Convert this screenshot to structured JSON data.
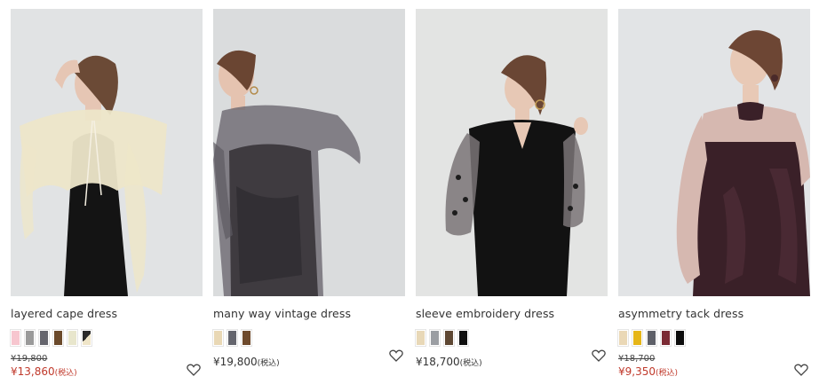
{
  "products": [
    {
      "name": "layered cape dress",
      "swatches": [
        "#f7c6cf",
        "#9a9a9a",
        "#66666e",
        "#6b4a2b",
        "#e8e6cc",
        "split"
      ],
      "old_price": "¥19,800",
      "price": "¥13,860",
      "tax": "(税込)",
      "sale": true,
      "photo": {
        "bg": "#e1e3e4",
        "dress": "#141414",
        "accent": "#ede6c9"
      }
    },
    {
      "name": "many way vintage dress",
      "swatches": [
        "#e9d8b5",
        "#65666e",
        "#6e4a2c"
      ],
      "old_price": "",
      "price": "¥19,800",
      "tax": "(税込)",
      "sale": false,
      "photo": {
        "bg": "#dadcdd",
        "dress": "#3f3b40",
        "accent": "#6b6870"
      }
    },
    {
      "name": "sleeve embroidery dress",
      "swatches": [
        "#e8d8b7",
        "#9b9ea3",
        "#5e4733",
        "#0f0f0f"
      ],
      "old_price": "",
      "price": "¥18,700",
      "tax": "(税込)",
      "sale": false,
      "photo": {
        "bg": "#e3e4e3",
        "dress": "#121212",
        "accent": "#7a7477"
      }
    },
    {
      "name": "asymmetry tack dress",
      "swatches": [
        "#ead8b6",
        "#e6b618",
        "#5e6068",
        "#7b2a34",
        "#0d0d0d"
      ],
      "old_price": "¥18,700",
      "price": "¥9,350",
      "tax": "(税込)",
      "sale": true,
      "photo": {
        "bg": "#e2e4e6",
        "dress": "#3a2028",
        "accent": "#d6b8b0"
      }
    }
  ],
  "icons": {
    "favorite": "heart-outline-icon"
  },
  "colors": {
    "sale": "#c0392b",
    "text": "#333333"
  }
}
